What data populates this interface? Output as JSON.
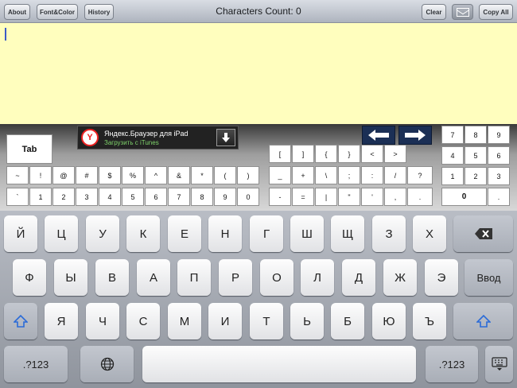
{
  "toolbar": {
    "about": "About",
    "font_color": "Font&Color",
    "history": "History",
    "characters_count": "Characters Count: 0",
    "clear": "Clear",
    "copy_all": "Copy All",
    "mail_icon": "mail-icon"
  },
  "ad": {
    "title": "Яндекс.Браузер для iPad",
    "subtitle": "Загрузить с iTunes",
    "logo_letter": "Y"
  },
  "extra_keys": {
    "tab": "Tab",
    "row1": [
      "[",
      "]",
      "{",
      "}",
      "<",
      ">"
    ],
    "row2": [
      "~",
      "!",
      "@",
      "#",
      "$",
      "%",
      "^",
      "&",
      "*",
      "(",
      ")",
      "_",
      "+",
      "\\",
      ";",
      ":",
      "/",
      "?"
    ],
    "row3": [
      "`",
      "1",
      "2",
      "3",
      "4",
      "5",
      "6",
      "7",
      "8",
      "9",
      "0",
      "-",
      "=",
      "|",
      "\"",
      "'",
      ",",
      "."
    ],
    "numpad": [
      "7",
      "8",
      "9",
      "4",
      "5",
      "6",
      "1",
      "2",
      "3",
      "0",
      "."
    ]
  },
  "keyboard": {
    "row1": [
      "Й",
      "Ц",
      "У",
      "К",
      "Е",
      "Н",
      "Г",
      "Ш",
      "Щ",
      "З",
      "Х"
    ],
    "row2": [
      "Ф",
      "Ы",
      "В",
      "А",
      "П",
      "Р",
      "О",
      "Л",
      "Д",
      "Ж",
      "Э"
    ],
    "row3": [
      "Я",
      "Ч",
      "С",
      "М",
      "И",
      "Т",
      "Ь",
      "Б",
      "Ю",
      "Ъ"
    ],
    "enter": "Ввод",
    "numbers_left": ".?123",
    "numbers_right": ".?123"
  },
  "colors": {
    "text_area": "#fffebe",
    "arrow_keys": "#1b2f55",
    "shift_icon": "#2a6bd8"
  }
}
